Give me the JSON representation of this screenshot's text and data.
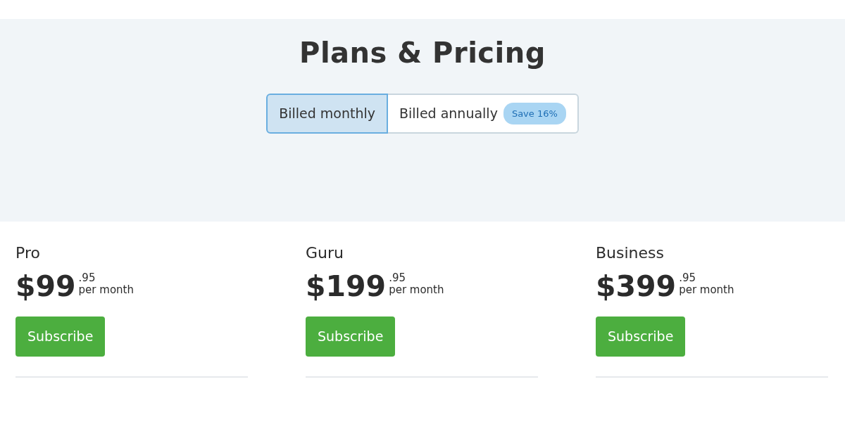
{
  "title": "Plans & Pricing",
  "billing_options": [
    {
      "label": "Billed monthly",
      "selected": true
    },
    {
      "label": "Billed annually",
      "selected": false,
      "badge": "Save 16%"
    }
  ],
  "plans": [
    {
      "name": "Pro",
      "price": "$99",
      "cents": ".95",
      "period": "per month",
      "button": "Subscribe"
    },
    {
      "name": "Guru",
      "price": "$199",
      "cents": ".95",
      "period": "per month",
      "button": "Subscribe"
    },
    {
      "name": "Business",
      "price": "$399",
      "cents": ".95",
      "period": "per month",
      "button": "Subscribe"
    }
  ]
}
